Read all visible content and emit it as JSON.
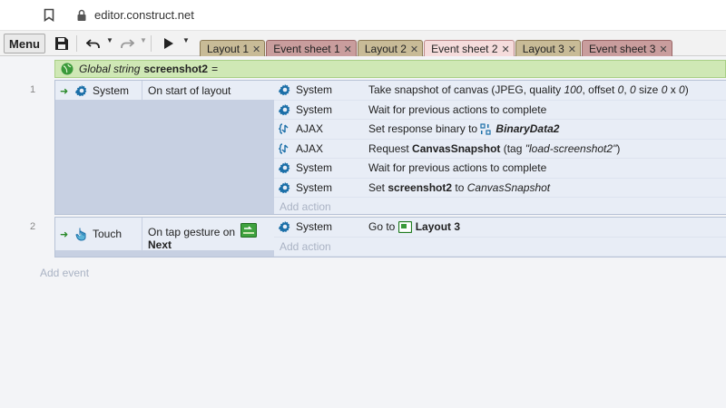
{
  "browser": {
    "url": "editor.construct.net"
  },
  "toolbar": {
    "menu_label": "Menu",
    "tabs": [
      {
        "label": "Layout 1",
        "kind": "layout",
        "active": false
      },
      {
        "label": "Event sheet 1",
        "kind": "events",
        "active": false
      },
      {
        "label": "Layout 2",
        "kind": "layout",
        "active": false
      },
      {
        "label": "Event sheet 2",
        "kind": "events",
        "active": true
      },
      {
        "label": "Layout 3",
        "kind": "layout",
        "active": false
      },
      {
        "label": "Event sheet 3",
        "kind": "events",
        "active": false
      }
    ],
    "close_glyph": "✕"
  },
  "sheet": {
    "global": {
      "kind": "Global string",
      "name": "screenshot2",
      "suffix": "="
    },
    "events": [
      {
        "number": "1",
        "condition": {
          "object": "System",
          "text": "On start of layout"
        },
        "actions": [
          {
            "object": "System",
            "icon": "gear-icon",
            "parts": [
              "Take snapshot of canvas (JPEG, quality ",
              "100",
              ", offset ",
              "0",
              ", ",
              "0",
              " size ",
              "0",
              " x ",
              "0",
              ")"
            ]
          },
          {
            "object": "System",
            "icon": "gear-icon",
            "parts": [
              "Wait for previous actions to complete"
            ]
          },
          {
            "object": "AJAX",
            "icon": "ajax-icon",
            "parts": [
              "Set response binary to ",
              "BinaryData2"
            ]
          },
          {
            "object": "AJAX",
            "icon": "ajax-icon",
            "parts": [
              "Request ",
              "CanvasSnapshot",
              " (tag ",
              "\"load-screenshot2\"",
              ")"
            ]
          },
          {
            "object": "System",
            "icon": "gear-icon",
            "parts": [
              "Wait for previous actions to complete"
            ]
          },
          {
            "object": "System",
            "icon": "gear-icon",
            "parts": [
              "Set ",
              "screenshot2",
              " to ",
              "CanvasSnapshot"
            ]
          }
        ],
        "add_action": "Add action"
      },
      {
        "number": "2",
        "condition": {
          "object": "Touch",
          "text": "On tap gesture on",
          "target": "Next"
        },
        "actions": [
          {
            "object": "System",
            "icon": "gear-icon",
            "parts": [
              "Go to ",
              "Layout 3"
            ]
          }
        ],
        "add_action": "Add action"
      }
    ],
    "add_event": "Add event"
  },
  "colors": {
    "accent_green": "#2a8a2a",
    "gear_blue": "#1b6fa8"
  }
}
